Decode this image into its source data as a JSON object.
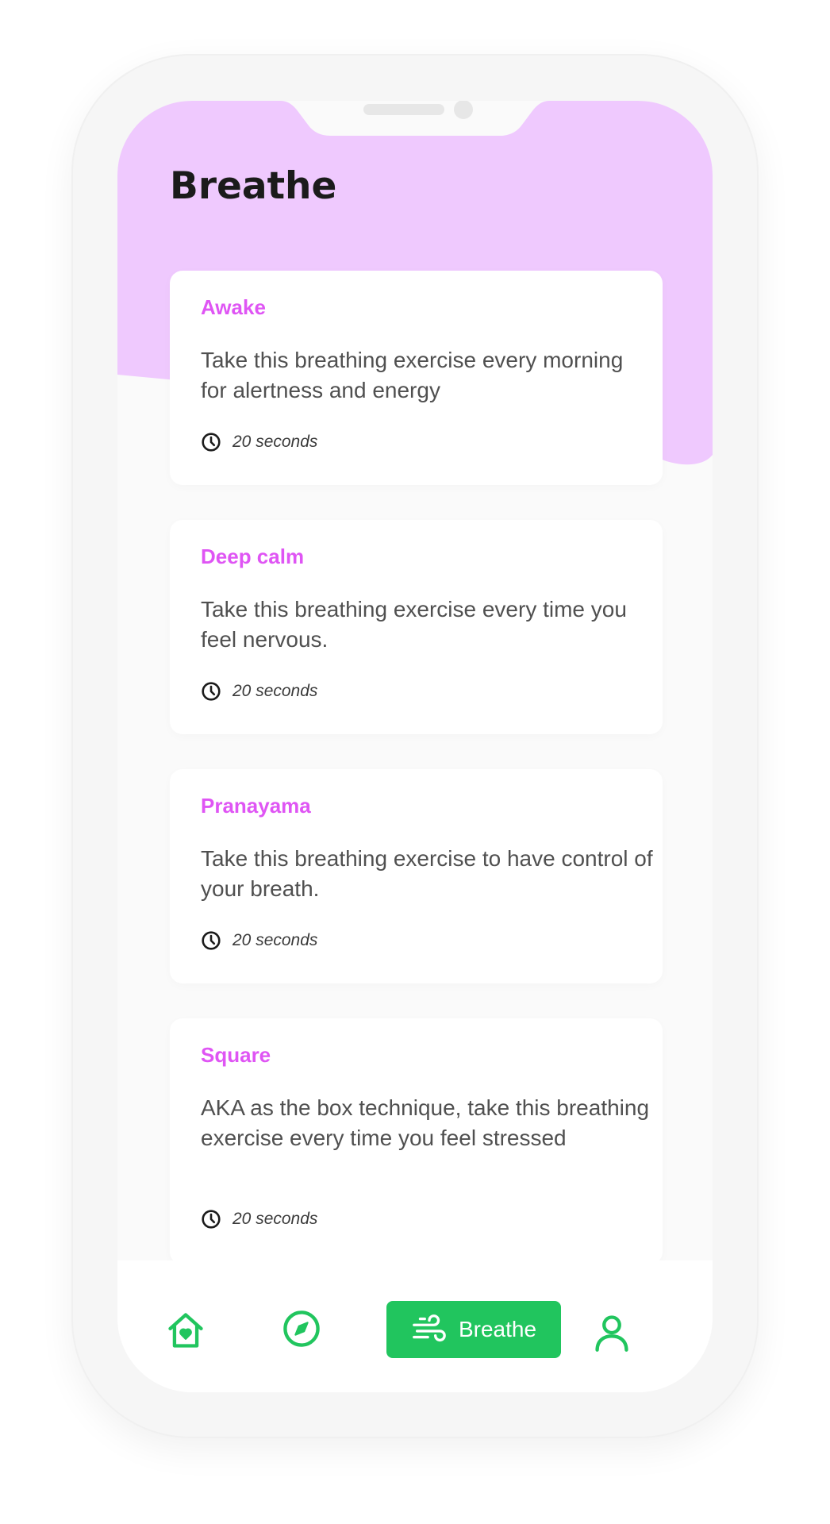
{
  "colors": {
    "accent": "#df55f4",
    "header_bg": "#efc9fe",
    "nav_green": "#21c55e",
    "text_dark": "#1b1b1b",
    "text_body": "#505050"
  },
  "header": {
    "title": "Breathe"
  },
  "exercises": [
    {
      "title": "Awake",
      "description": "Take this breathing exercise every morning for alertness and energy",
      "duration": "20 seconds",
      "icon": "clock-icon"
    },
    {
      "title": "Deep calm",
      "description": "Take this breathing exercise every time you feel nervous.",
      "duration": "20 seconds",
      "icon": "clock-icon"
    },
    {
      "title": "Pranayama",
      "description": "Take this breathing exercise to have control of your breath.",
      "duration": "20 seconds",
      "icon": "clock-icon"
    },
    {
      "title": "Square",
      "description": "AKA as the box technique, take this breathing exercise every time you feel stressed",
      "duration": "20 seconds",
      "icon": "clock-icon"
    }
  ],
  "nav": {
    "items": [
      {
        "icon": "home-heart-icon",
        "label": ""
      },
      {
        "icon": "compass-icon",
        "label": ""
      },
      {
        "icon": "wind-icon",
        "label": "Breathe",
        "active": true
      },
      {
        "icon": "user-icon",
        "label": ""
      }
    ]
  }
}
